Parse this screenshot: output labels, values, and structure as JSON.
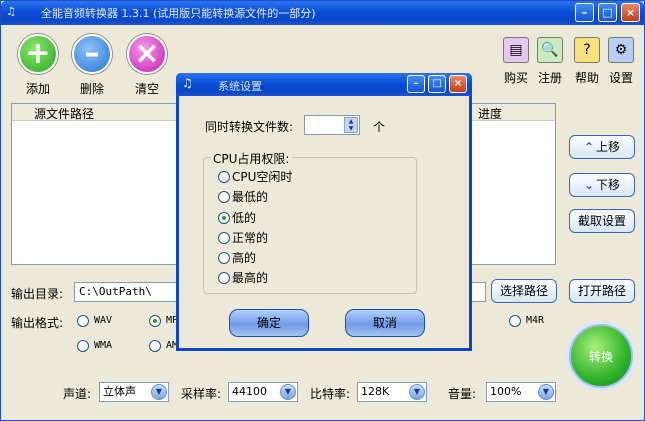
{
  "window": {
    "title": "全能音频转换器 1.3.1 (试用版只能转换源文件的一部分)"
  },
  "toolbar": {
    "add": "添加",
    "delete": "删除",
    "clear": "清空"
  },
  "right_toolbar": {
    "buy": "购买",
    "register": "注册",
    "help": "帮助",
    "settings": "设置"
  },
  "file_list": {
    "col_path": "源文件路径",
    "col_progress": "进度"
  },
  "side_buttons": {
    "move_up": "上移",
    "move_down": "下移",
    "trim_settings": "截取设置",
    "open_path": "打开路径"
  },
  "output": {
    "dir_label": "输出目录:",
    "dir_value": "C:\\OutPath\\",
    "choose_path": "选择路径",
    "format_label": "输出格式:",
    "formats_row1": [
      "WAV",
      "MP",
      "M4R"
    ],
    "formats_row2": [
      "WMA",
      "AM"
    ],
    "selected_format": "MP"
  },
  "audio": {
    "channel_label": "声道:",
    "channel_value": "立体声",
    "samplerate_label": "采样率:",
    "samplerate_value": "44100",
    "bitrate_label": "比特率:",
    "bitrate_value": "128K",
    "volume_label": "音量:",
    "volume_value": "100%"
  },
  "convert_button": "转换",
  "dialog": {
    "title": "系统设置",
    "concurrent_label": "同时转换文件数:",
    "concurrent_value": "",
    "concurrent_unit": "个",
    "cpu_group": "CPU占用权限:",
    "cpu_options": [
      "CPU空闲时",
      "最低的",
      "低的",
      "正常的",
      "高的",
      "最高的"
    ],
    "cpu_selected": "低的",
    "ok": "确定",
    "cancel": "取消"
  },
  "colors": {
    "titlebar": "#0a4fd8",
    "window_bg": "#ece9d8",
    "accent_green": "#2fb32a",
    "clear_magenta": "#d21cc4"
  }
}
